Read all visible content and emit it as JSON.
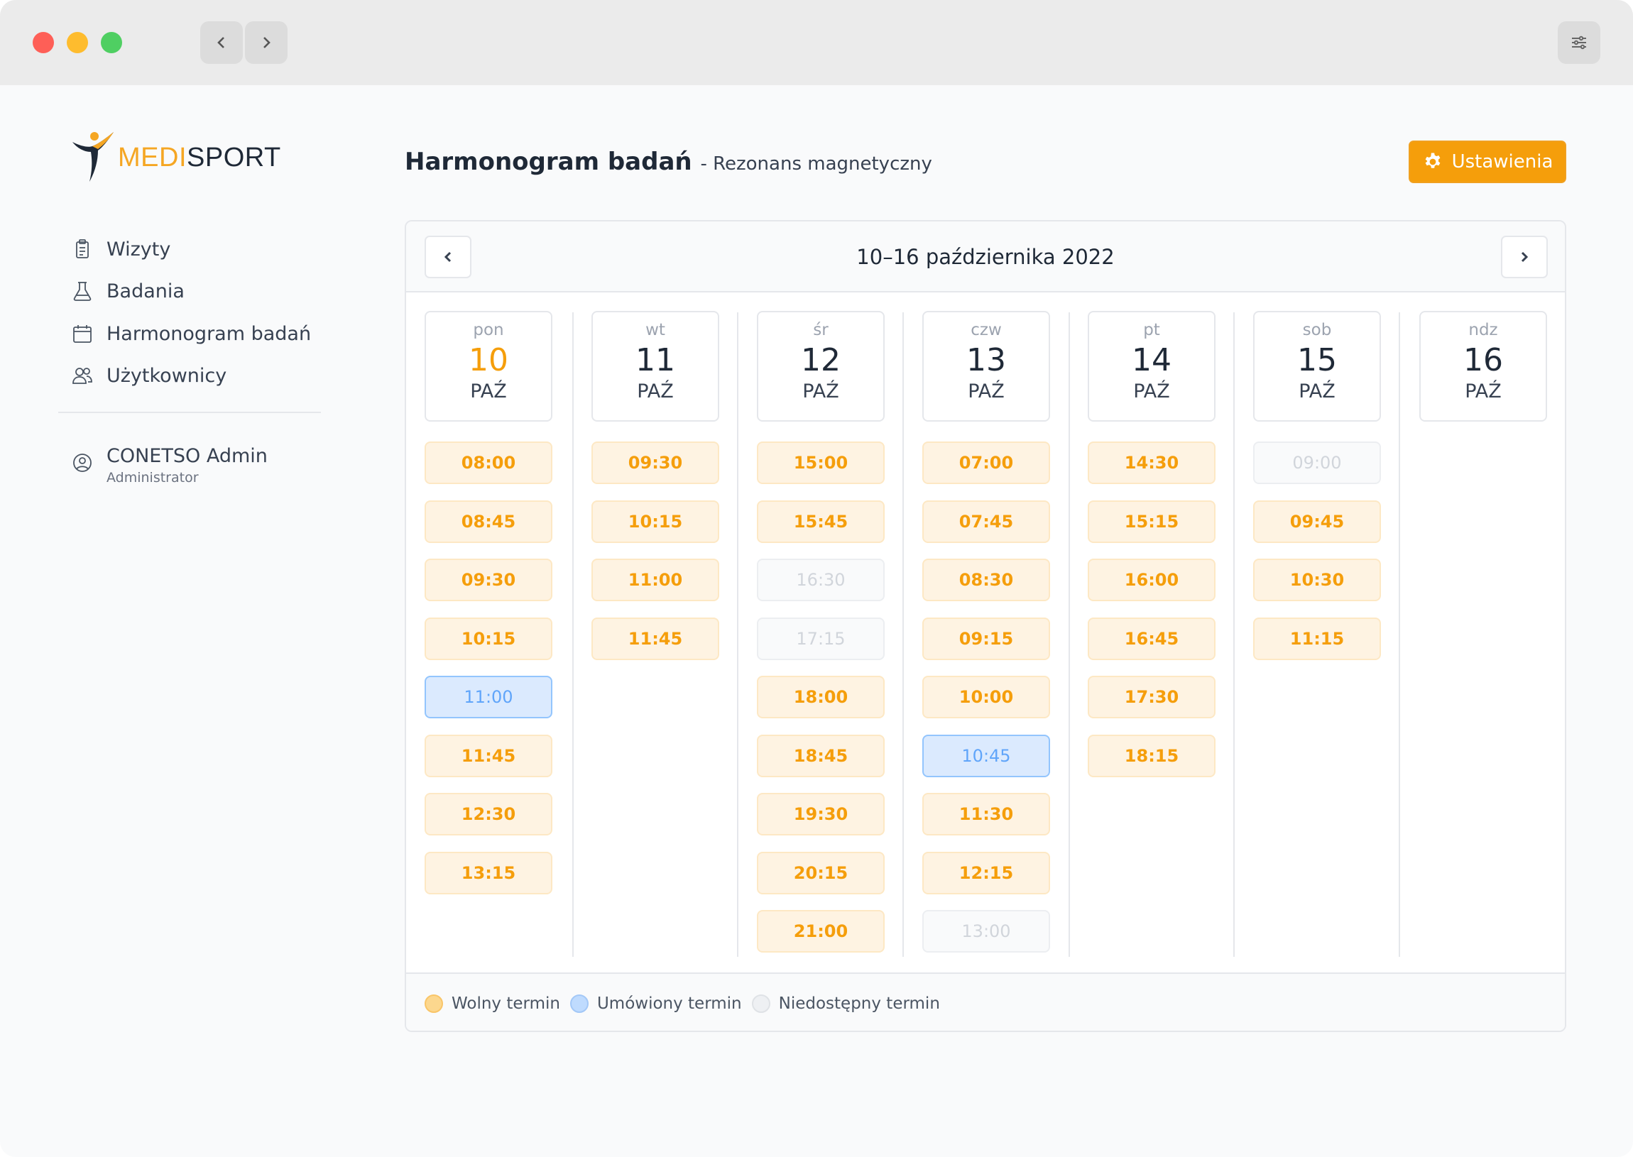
{
  "sidebar": {
    "logo": {
      "medi": "MEDI",
      "sport": "SPORT"
    },
    "items": [
      {
        "label": "Wizyty",
        "icon": "clipboard-icon"
      },
      {
        "label": "Badania",
        "icon": "flask-icon"
      },
      {
        "label": "Harmonogram badań",
        "icon": "calendar-icon"
      },
      {
        "label": "Użytkownicy",
        "icon": "users-icon"
      }
    ],
    "user": {
      "name": "CONETSO Admin",
      "role": "Administrator"
    }
  },
  "header": {
    "title": "Harmonogram badań",
    "subtitle": "- Rezonans magnetyczny",
    "settings_label": "Ustawienia"
  },
  "calendar": {
    "week_label": "10–16 października 2022",
    "days": [
      {
        "abbr": "pon",
        "num": "10",
        "month": "PAŹ",
        "today": true,
        "slots": [
          {
            "time": "08:00",
            "status": "free"
          },
          {
            "time": "08:45",
            "status": "free"
          },
          {
            "time": "09:30",
            "status": "free"
          },
          {
            "time": "10:15",
            "status": "free"
          },
          {
            "time": "11:00",
            "status": "booked"
          },
          {
            "time": "11:45",
            "status": "free"
          },
          {
            "time": "12:30",
            "status": "free"
          },
          {
            "time": "13:15",
            "status": "free"
          }
        ]
      },
      {
        "abbr": "wt",
        "num": "11",
        "month": "PAŹ",
        "slots": [
          {
            "time": "09:30",
            "status": "free"
          },
          {
            "time": "10:15",
            "status": "free"
          },
          {
            "time": "11:00",
            "status": "free"
          },
          {
            "time": "11:45",
            "status": "free"
          }
        ]
      },
      {
        "abbr": "śr",
        "num": "12",
        "month": "PAŹ",
        "slots": [
          {
            "time": "15:00",
            "status": "free"
          },
          {
            "time": "15:45",
            "status": "free"
          },
          {
            "time": "16:30",
            "status": "unavailable"
          },
          {
            "time": "17:15",
            "status": "unavailable"
          },
          {
            "time": "18:00",
            "status": "free"
          },
          {
            "time": "18:45",
            "status": "free"
          },
          {
            "time": "19:30",
            "status": "free"
          },
          {
            "time": "20:15",
            "status": "free"
          },
          {
            "time": "21:00",
            "status": "free"
          }
        ]
      },
      {
        "abbr": "czw",
        "num": "13",
        "month": "PAŹ",
        "slots": [
          {
            "time": "07:00",
            "status": "free"
          },
          {
            "time": "07:45",
            "status": "free"
          },
          {
            "time": "08:30",
            "status": "free"
          },
          {
            "time": "09:15",
            "status": "free"
          },
          {
            "time": "10:00",
            "status": "free"
          },
          {
            "time": "10:45",
            "status": "booked"
          },
          {
            "time": "11:30",
            "status": "free"
          },
          {
            "time": "12:15",
            "status": "free"
          },
          {
            "time": "13:00",
            "status": "unavailable"
          }
        ]
      },
      {
        "abbr": "pt",
        "num": "14",
        "month": "PAŹ",
        "slots": [
          {
            "time": "14:30",
            "status": "free"
          },
          {
            "time": "15:15",
            "status": "free"
          },
          {
            "time": "16:00",
            "status": "free"
          },
          {
            "time": "16:45",
            "status": "free"
          },
          {
            "time": "17:30",
            "status": "free"
          },
          {
            "time": "18:15",
            "status": "free"
          }
        ]
      },
      {
        "abbr": "sob",
        "num": "15",
        "month": "PAŹ",
        "slots": [
          {
            "time": "09:00",
            "status": "unavailable"
          },
          {
            "time": "09:45",
            "status": "free"
          },
          {
            "time": "10:30",
            "status": "free"
          },
          {
            "time": "11:15",
            "status": "free"
          }
        ]
      },
      {
        "abbr": "ndz",
        "num": "16",
        "month": "PAŹ",
        "slots": []
      }
    ]
  },
  "legend": [
    {
      "label": "Wolny termin",
      "status": "free"
    },
    {
      "label": "Umówiony termin",
      "status": "booked"
    },
    {
      "label": "Niedostępny termin",
      "status": "unavailable"
    }
  ],
  "colors": {
    "accent": "#f59e0b",
    "free_bg": "#fef3e2",
    "booked_bg": "#dbeafe",
    "unavailable_bg": "#f9fafb"
  }
}
